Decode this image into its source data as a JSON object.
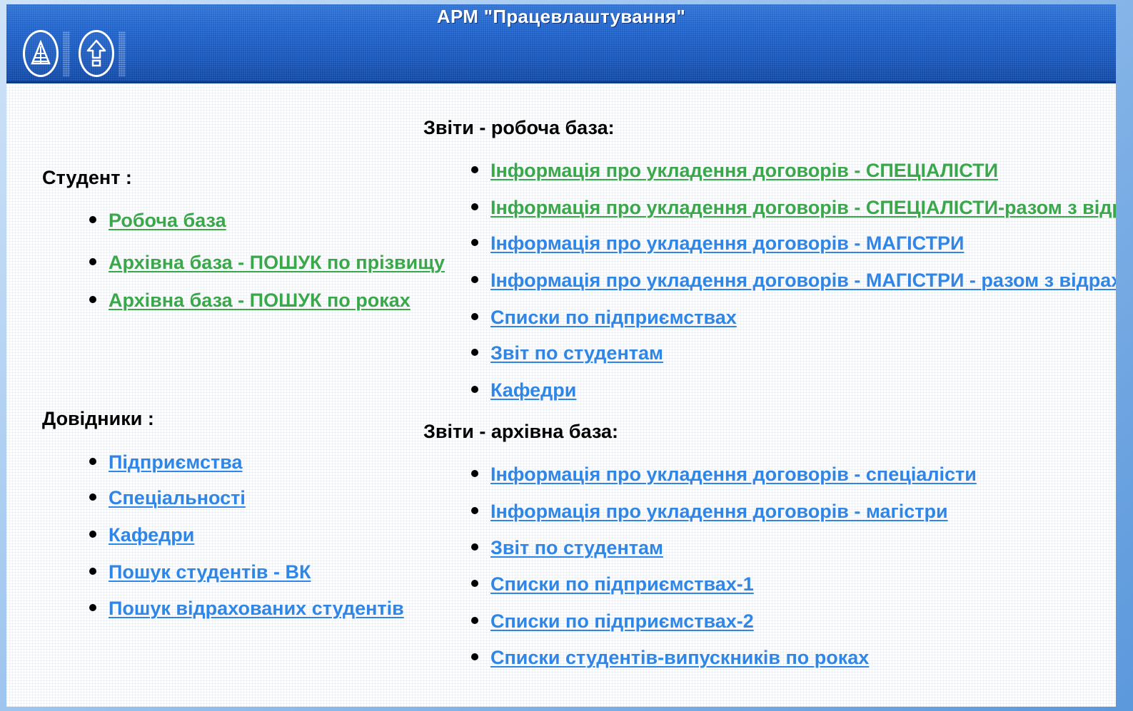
{
  "app_title": "АРМ \"Працевлаштування\"",
  "toolbar": {
    "home_icon": "tree-home-icon",
    "up_icon": "arrow-up-icon"
  },
  "student": {
    "title": "Студент :",
    "items": [
      {
        "label": "Робоча база",
        "color": "#3aa84a"
      },
      {
        "label": "Архівна база - ПОШУК по прізвищу",
        "color": "#3aa84a"
      },
      {
        "label": "Архівна база - ПОШУК по роках",
        "color": "#3aa84a"
      }
    ]
  },
  "directories": {
    "title": "Довідники :",
    "items": [
      {
        "label": "Підприємства"
      },
      {
        "label": "Спеціальності"
      },
      {
        "label": "Кафедри"
      },
      {
        "label": "Пошук студентів - ВК"
      },
      {
        "label": "Пошук відрахованих студентів"
      }
    ]
  },
  "reports_work": {
    "title": "Звіти - робоча база:",
    "items": [
      {
        "label": "Інформація про укладення договорів - СПЕЦІАЛІСТИ"
      },
      {
        "label": "Інформація про укладення договорів - СПЕЦІАЛІСТИ-разом з відрахов"
      },
      {
        "label": "Інформація про укладення договорів - МАГІСТРИ"
      },
      {
        "label": "Інформація про укладення договорів - МАГІСТРИ - разом з відраховані"
      },
      {
        "label": "Списки по підприємствах"
      },
      {
        "label": "Звіт по студентам"
      },
      {
        "label": "Кафедри"
      }
    ]
  },
  "reports_archive": {
    "title": "Звіти - архівна база:",
    "items": [
      {
        "label": "Інформація про укладення договорів - спеціалісти"
      },
      {
        "label": "Інформація про укладення договорів - магістри"
      },
      {
        "label": "Звіт по студентам"
      },
      {
        "label": "Списки по підприємствах-1"
      },
      {
        "label": "Списки по підприємствах-2"
      },
      {
        "label": "Списки студентів-випускників по роках"
      }
    ]
  },
  "colors": {
    "link_green": "#3aa84a",
    "link_blue": "#2f86e6",
    "header_blue": "#1e63cc"
  }
}
